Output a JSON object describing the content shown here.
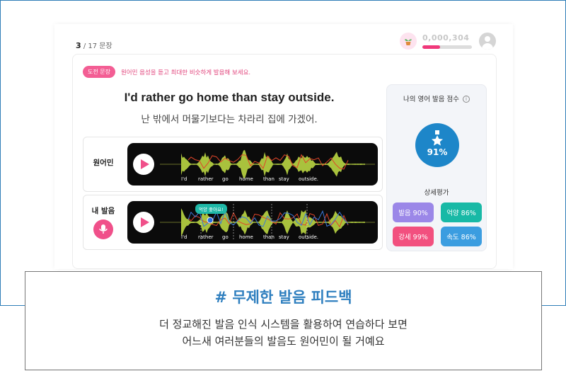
{
  "progress": {
    "current": "3",
    "total": "/ 17 문장"
  },
  "user": {
    "points": "0,000,304",
    "xp_level": 0.36,
    "plant_icon": "potted-plant-icon",
    "avatar_icon": "user-avatar-icon"
  },
  "challenge": {
    "badge": "도전 문장",
    "instruction": "원어민 음성을 듣고 최대한 비슷하게 발음해 보세요."
  },
  "sentence": {
    "english": "I'd rather go home than stay outside.",
    "korean": "난 밖에서 머물기보다는 차라리 집에 가겠어."
  },
  "native": {
    "label": "원어민",
    "words": [
      "I'd",
      "rather",
      "go",
      "home",
      "than",
      "stay",
      "outside."
    ]
  },
  "mine": {
    "label": "내 발음",
    "tooltip": "억양 좋아요!",
    "words": [
      "I'd",
      "rather",
      "go",
      "home",
      "than",
      "stay",
      "outside."
    ]
  },
  "score": {
    "title": "나의 영어 발음 점수",
    "info_icon": "ⓘ",
    "value": "91%"
  },
  "details": {
    "title": "상세평가",
    "items": [
      {
        "label": "발음 90%",
        "color": "#9b87e8"
      },
      {
        "label": "억양 86%",
        "color": "#18b9a6"
      },
      {
        "label": "강세 99%",
        "color": "#f2507f"
      },
      {
        "label": "속도 86%",
        "color": "#3b9de0"
      }
    ]
  },
  "caption": {
    "title": "# 무제한 발음 피드백",
    "line1": "더 정교해진 발음 인식 시스템을 활용하여 연습하다 보면",
    "line2": "어느새 여러분들의 발음도 원어민이 될 거예요"
  }
}
